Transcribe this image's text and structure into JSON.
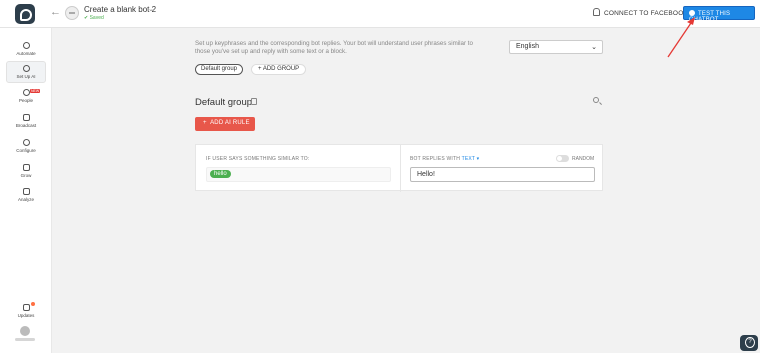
{
  "topbar": {
    "bot_name": "Create a blank bot 2",
    "saved_status": "Saved",
    "connect_label": "CONNECT TO FACEBOOK",
    "test_label": "TEST THIS CHATBOT"
  },
  "sidebar": {
    "items": [
      {
        "label": "Automate",
        "icon": "automate-icon"
      },
      {
        "label": "Set Up AI",
        "icon": "ai-icon",
        "active": true
      },
      {
        "label": "People",
        "icon": "people-icon",
        "badge": "NEW"
      },
      {
        "label": "Broadcast",
        "icon": "broadcast-icon"
      },
      {
        "label": "Configure",
        "icon": "gear-icon"
      },
      {
        "label": "Grow",
        "icon": "grow-icon"
      },
      {
        "label": "Analyze",
        "icon": "analyze-icon"
      },
      {
        "label": "Updates",
        "icon": "updates-icon"
      }
    ]
  },
  "main": {
    "description": "Set up keyphrases and the corresponding bot replies. Your bot will understand user phrases similar to those you've set up and reply with some text or a block.",
    "language": "English",
    "groups": [
      "Default group"
    ],
    "add_group_label": "ADD GROUP",
    "group_title": "Default group",
    "add_rule_label": "ADD AI RULE",
    "rule": {
      "if_label": "IF USER SAYS SOMETHING SIMILAR TO:",
      "keyword": "hello",
      "replies_label": "BOT REPLIES WITH",
      "replies_type": "TEXT",
      "random_label": "RANDOM",
      "reply_text": "Hello!"
    }
  },
  "colors": {
    "accent": "#1e88e5",
    "danger": "#e8574a",
    "tag": "#4caf50",
    "annotation_arrow": "#e53935"
  }
}
